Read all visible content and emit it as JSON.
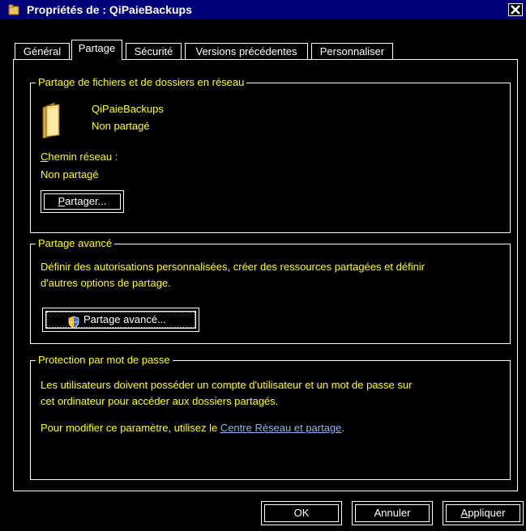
{
  "window": {
    "title": "Propriétés de : QiPaieBackups"
  },
  "tabs": [
    {
      "label": "Général"
    },
    {
      "label": "Partage"
    },
    {
      "label": "Sécurité"
    },
    {
      "label": "Versions précédentes"
    },
    {
      "label": "Personnaliser"
    }
  ],
  "active_tab": "Partage",
  "network_sharing": {
    "legend": "Partage de fichiers et de dossiers en réseau",
    "folder_name": "QiPaieBackups",
    "share_status": "Non partagé",
    "network_path_label_rest": "hemin réseau :",
    "network_path_label_accel": "C",
    "network_path_value": "Non partagé",
    "share_button_accel": "P",
    "share_button_rest": "artager..."
  },
  "advanced_sharing": {
    "legend": "Partage avancé",
    "description_line1": "Définir des autorisations personnalisées, créer des ressources partagées et définir",
    "description_line2": "d'autres options de partage.",
    "button_label": "Partage avancé..."
  },
  "password_protection": {
    "legend": "Protection par mot de passe",
    "line1": "Les utilisateurs doivent posséder un compte d'utilisateur et un mot de passe sur",
    "line2": "cet ordinateur pour accéder aux dossiers partagés.",
    "line3_prefix": "Pour modifier ce paramètre, utilisez le ",
    "link_text": "Centre Réseau et partage",
    "line3_suffix": "."
  },
  "footer": {
    "ok": "OK",
    "cancel": "Annuler",
    "apply_accel": "A",
    "apply_rest": "ppliquer"
  },
  "colors": {
    "background": "#000000",
    "titlebar": "#000078",
    "text": "#FFFF00",
    "button_text": "#FFFFFF",
    "link": "#8AB4FF",
    "folder": "#E8C25A"
  }
}
